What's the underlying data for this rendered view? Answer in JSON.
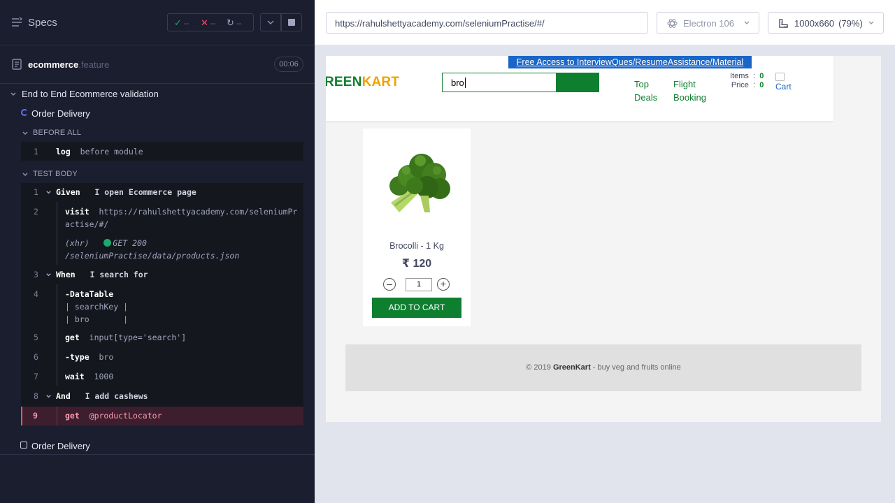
{
  "reporter": {
    "specs_label": "Specs",
    "stats": {
      "passed": "--",
      "failed": "--",
      "pending": "--"
    },
    "spec_file": {
      "name": "ecommerce",
      "ext": ".feature",
      "duration": "00:06"
    },
    "suite_title": "End to End Ecommerce validation",
    "test_title": "Order Delivery",
    "before_all_label": "BEFORE ALL",
    "test_body_label": "TEST BODY",
    "before_all": {
      "num": "1",
      "cmd": "log",
      "arg": "before module"
    },
    "steps": [
      {
        "num": "1",
        "cmd": "Given",
        "arg": "I open Ecommerce page"
      },
      {
        "num": "2",
        "cmd": "visit",
        "arg_line1": "https://rahulshettyacademy.com/seleniumPr",
        "arg_line2": "actise/#/"
      },
      {
        "xhr_label": "(xhr)",
        "xhr_status": "GET 200",
        "xhr_url": "/seleniumPractise/data/products.json"
      },
      {
        "num": "3",
        "cmd": "When",
        "arg": "I search for"
      },
      {
        "num": "4",
        "cmd": "-DataTable",
        "row1": "| searchKey |",
        "row2": "| bro       |"
      },
      {
        "num": "5",
        "cmd": "get",
        "arg": "input[type='search']"
      },
      {
        "num": "6",
        "cmd": "-type",
        "arg": "bro"
      },
      {
        "num": "7",
        "cmd": "wait",
        "arg": "1000"
      },
      {
        "num": "8",
        "cmd": "And",
        "arg": "I add cashews"
      },
      {
        "num": "9",
        "cmd": "get",
        "arg": "@productLocator"
      }
    ],
    "second_test_title": "Order Delivery"
  },
  "browser": {
    "url": "https://rahulshettyacademy.com/seleniumPractise/#/",
    "browser_label": "Electron 106",
    "viewport": "1000x660",
    "zoom": "(79%)"
  },
  "aut": {
    "promo": "Free Access to InterviewQues/ResumeAssistance/Material",
    "brand_part1": "REEN",
    "brand_part2": "KART",
    "search_value": "bro",
    "nav_top": [
      "Top",
      "Deals"
    ],
    "nav_flight": [
      "Flight",
      "Booking"
    ],
    "items_label": "Items",
    "items_value": "0",
    "price_label": "Price",
    "price_value": "0",
    "cart_label": "Cart",
    "product": {
      "name": "Brocolli - 1 Kg",
      "price": "₹ 120",
      "qty": "1",
      "dec": "–",
      "inc": "+",
      "add_label": "ADD TO CART"
    },
    "footer_prefix": "© 2019 ",
    "footer_brand": "GreenKart",
    "footer_suffix": " - buy veg and fruits online"
  },
  "colors": {
    "brand_green": "#0e7f2f",
    "brand_orange": "#f2a000",
    "promo_blue": "#1a66c8",
    "reporter_bg": "#1b1e2e",
    "error_pink": "#e45770"
  }
}
